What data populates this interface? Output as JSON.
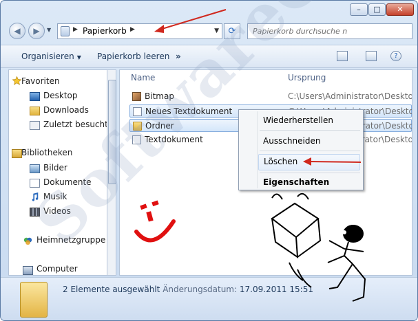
{
  "window": {
    "min_glyph": "–",
    "max_glyph": "□",
    "close_glyph": "✕"
  },
  "nav": {
    "back_glyph": "◀",
    "forward_glyph": "▶",
    "dropdown_glyph": "▼",
    "breadcrumb": "Papierkorb",
    "crumb_sep": "▶",
    "refresh_glyph": "⟳",
    "search_placeholder": "Papierkorb durchsuche n"
  },
  "toolbar": {
    "organize": "Organisieren",
    "organize_arrow": "▼",
    "empty_bin": "Papierkorb leeren",
    "more": "»"
  },
  "sidebar": {
    "favorites": {
      "header": "Favoriten",
      "items": [
        "Desktop",
        "Downloads",
        "Zuletzt besucht"
      ]
    },
    "libraries": {
      "header": "Bibliotheken",
      "items": [
        "Bilder",
        "Dokumente",
        "Musik",
        "Videos"
      ]
    },
    "homegroup": "Heimnetzgruppe",
    "computer": "Computer"
  },
  "content": {
    "columns": {
      "name": "Name",
      "origin": "Ursprung"
    },
    "files": [
      {
        "name": "Bitmap",
        "origin": "C:\\Users\\Administrator\\Desktop",
        "icon": "bitmap-icon",
        "selected": false
      },
      {
        "name": "Neues Textdokument",
        "origin": "C:\\Users\\Administrator\\Desktop",
        "icon": "text-document-icon",
        "selected": true
      },
      {
        "name": "Ordner",
        "origin": "C:\\Users\\Administrator\\Desktop",
        "icon": "folder-icon",
        "selected": true
      },
      {
        "name": "Textdokument",
        "origin": "C:\\Users\\Administrator\\Desktop",
        "icon": "text-document-icon",
        "selected": false
      }
    ]
  },
  "context_menu": {
    "items": [
      "Wiederherstellen",
      "Ausschneiden",
      "Löschen",
      "Eigenschaften"
    ]
  },
  "status": {
    "selection": "2 Elemente ausgewählt",
    "date_label": "Änderungsdatum:",
    "date_value": "17.09.2011 15:51"
  },
  "watermark": "SoftwareOK.de",
  "colors": {
    "accent": "#1e395b",
    "selection_border": "#84acdd",
    "arrow": "#d0281e",
    "smiley": "#e01010"
  }
}
